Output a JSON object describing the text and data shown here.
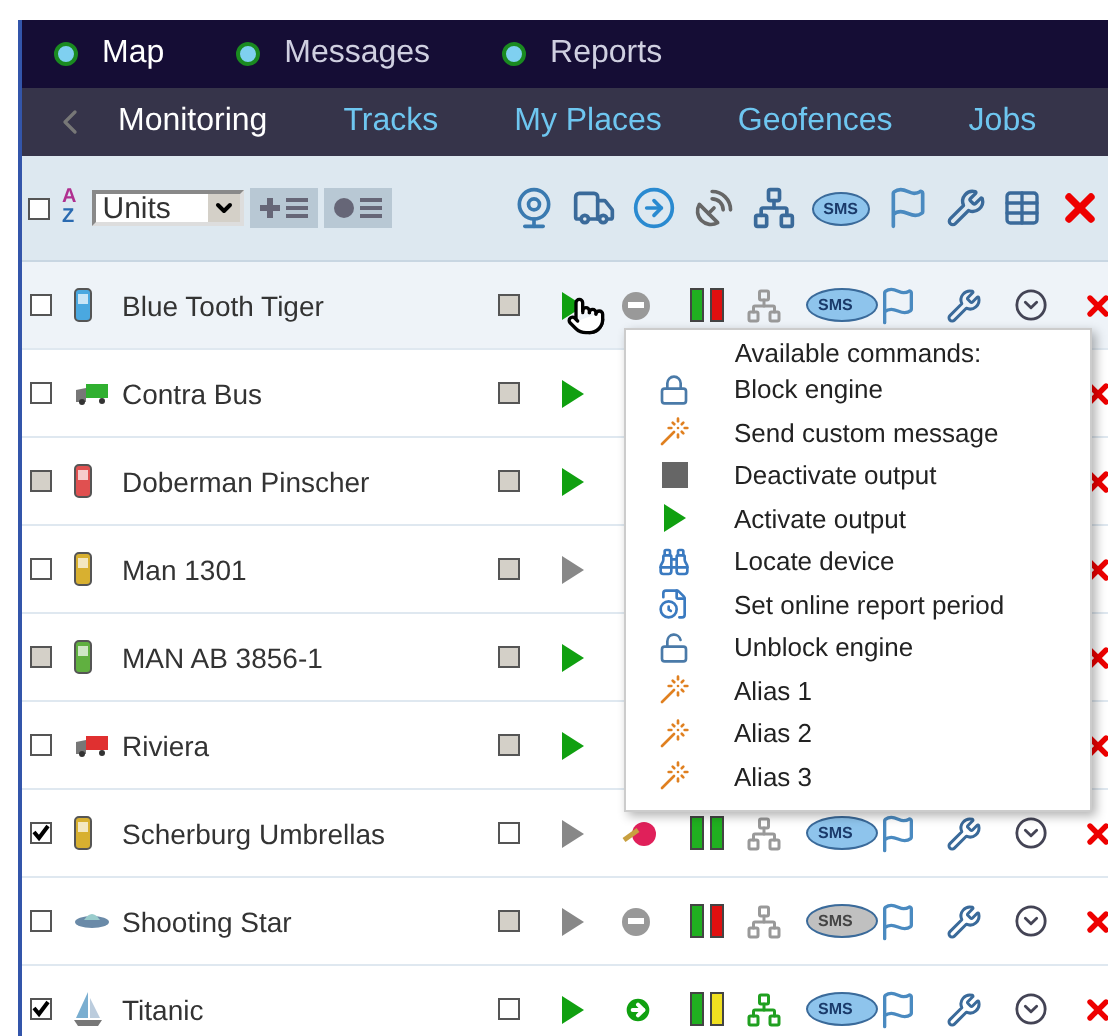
{
  "main_tabs": [
    {
      "label": "Map",
      "selected": true
    },
    {
      "label": "Messages",
      "selected": false
    },
    {
      "label": "Reports",
      "selected": false
    }
  ],
  "sub_tabs": [
    {
      "label": "Monitoring",
      "selected": true
    },
    {
      "label": "Tracks",
      "selected": false
    },
    {
      "label": "My Places",
      "selected": false
    },
    {
      "label": "Geofences",
      "selected": false
    },
    {
      "label": "Jobs",
      "selected": false
    }
  ],
  "toolbar": {
    "select_all_checked": false,
    "sort_letters": [
      "A",
      "Z"
    ],
    "filter": {
      "value": "Units"
    },
    "sms_label": "SMS"
  },
  "units": [
    {
      "name": "Blue Tooth Tiger",
      "checked": false,
      "check_disabled": false,
      "kind": "phone",
      "color": "#4aa8e0",
      "visible_disabled": true,
      "play_active": true,
      "hovered": true,
      "controls": {
        "engine": {
          "kind": "stop"
        },
        "outputs": [
          {
            "color": "#20b020"
          },
          {
            "color": "#e01010"
          }
        ],
        "network_on": false,
        "sms_on": true,
        "sms_label": "SMS"
      }
    },
    {
      "name": "Contra Bus",
      "checked": false,
      "check_disabled": false,
      "kind": "truck",
      "color": "#30b030",
      "visible_disabled": true,
      "play_active": true,
      "hovered": false
    },
    {
      "name": "Doberman Pinscher",
      "checked": false,
      "check_disabled": true,
      "kind": "phone",
      "color": "#e05050",
      "visible_disabled": true,
      "play_active": true,
      "hovered": false
    },
    {
      "name": "Man 1301",
      "checked": false,
      "check_disabled": false,
      "kind": "phone",
      "color": "#d8b030",
      "visible_disabled": true,
      "play_active": false,
      "hovered": false
    },
    {
      "name": "MAN AB 3856-1",
      "checked": false,
      "check_disabled": true,
      "kind": "phone",
      "color": "#60b040",
      "visible_disabled": true,
      "play_active": true,
      "hovered": false
    },
    {
      "name": "Riviera",
      "checked": false,
      "check_disabled": false,
      "kind": "truck",
      "color": "#e03030",
      "visible_disabled": true,
      "play_active": true,
      "hovered": false
    },
    {
      "name": "Scherburg Umbrellas",
      "checked": true,
      "check_disabled": false,
      "kind": "phone",
      "color": "#d8b030",
      "visible_disabled": false,
      "play_active": false,
      "hovered": false,
      "controls": {
        "engine": {
          "kind": "key"
        },
        "outputs": [
          {
            "color": "#20b020"
          },
          {
            "color": "#20b020"
          }
        ],
        "network_on": false,
        "sms_on": true,
        "sms_label": "SMS"
      }
    },
    {
      "name": "Shooting Star",
      "checked": false,
      "check_disabled": false,
      "kind": "ufo",
      "color": "#6a8aa8",
      "visible_disabled": true,
      "play_active": false,
      "hovered": false,
      "controls": {
        "engine": {
          "kind": "stop"
        },
        "outputs": [
          {
            "color": "#20b020"
          },
          {
            "color": "#e01010"
          }
        ],
        "network_on": false,
        "sms_on": false,
        "sms_label": "SMS"
      }
    },
    {
      "name": "Titanic",
      "checked": true,
      "check_disabled": false,
      "kind": "boat",
      "color": "#7aaed0",
      "visible_disabled": false,
      "play_active": true,
      "hovered": false,
      "controls": {
        "engine": {
          "kind": "go"
        },
        "outputs": [
          {
            "color": "#20b020"
          },
          {
            "color": "#f0e020"
          }
        ],
        "network_on": true,
        "sms_on": true,
        "sms_label": "SMS"
      }
    }
  ],
  "popup": {
    "title": "Available commands:",
    "commands": [
      {
        "label": "Block engine",
        "kind": "lock"
      },
      {
        "label": "Send custom message",
        "kind": "wand"
      },
      {
        "label": "Deactivate output",
        "kind": "square"
      },
      {
        "label": "Activate output",
        "kind": "play"
      },
      {
        "label": "Locate device",
        "kind": "binoculars"
      },
      {
        "label": "Set online report period",
        "kind": "clock-doc"
      },
      {
        "label": "Unblock engine",
        "kind": "unlock"
      },
      {
        "label": "Alias 1",
        "kind": "wand"
      },
      {
        "label": "Alias 2",
        "kind": "wand"
      },
      {
        "label": "Alias 3",
        "kind": "wand"
      }
    ]
  }
}
